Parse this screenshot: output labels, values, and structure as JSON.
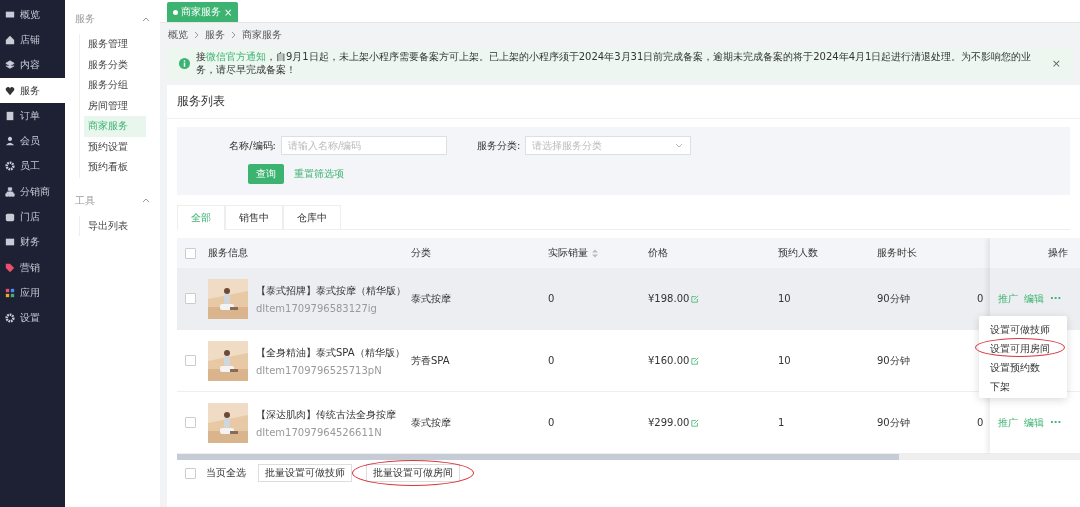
{
  "nav": [
    {
      "label": "概览",
      "selected": false
    },
    {
      "label": "店铺",
      "selected": false
    },
    {
      "label": "内容",
      "selected": false
    },
    {
      "label": "服务",
      "selected": true
    },
    {
      "label": "订单",
      "selected": false
    },
    {
      "label": "会员",
      "selected": false
    },
    {
      "label": "员工",
      "selected": false
    },
    {
      "label": "分销商",
      "selected": false
    },
    {
      "label": "门店",
      "selected": false
    },
    {
      "label": "财务",
      "selected": false
    },
    {
      "label": "营销",
      "selected": false
    },
    {
      "label": "应用",
      "selected": false
    },
    {
      "label": "设置",
      "selected": false
    }
  ],
  "subnav": [
    {
      "title": "服务",
      "expanded": true,
      "items": [
        {
          "label": "服务管理",
          "selected": false
        },
        {
          "label": "服务分类",
          "selected": false
        },
        {
          "label": "服务分组",
          "selected": false
        },
        {
          "label": "房间管理",
          "selected": false
        },
        {
          "label": "商家服务",
          "selected": true
        },
        {
          "label": "预约设置",
          "selected": false
        },
        {
          "label": "预约看板",
          "selected": false
        }
      ]
    },
    {
      "title": "工具",
      "expanded": true,
      "items": [
        {
          "label": "导出列表",
          "selected": false
        }
      ]
    }
  ],
  "page_tab": {
    "label": "商家服务",
    "close": "×"
  },
  "breadcrumb": [
    "概览",
    "服务",
    "商家服务"
  ],
  "notice": {
    "text": "接",
    "link": "微信官方通知",
    "rest": "，自9月1日起，未上架小程序需要备案方可上架。已上架的小程序须于2024年3月31日前完成备案，逾期未完成备案的将于2024年4月1日起进行清退处理。为不影响您的业务，请尽早完成备案！",
    "close": "×"
  },
  "card_title": "服务列表",
  "filters": [
    {
      "label": "名称/编码:",
      "placeholder": "请输入名称/编码",
      "kind": "input"
    },
    {
      "label": "服务分类:",
      "placeholder": "请选择服务分类",
      "kind": "select"
    }
  ],
  "query_button": "查询",
  "reset_link": "重置筛选项",
  "tabs": [
    {
      "label": "全部",
      "selected": true
    },
    {
      "label": "销售中",
      "selected": false
    },
    {
      "label": "仓库中",
      "selected": false
    }
  ],
  "table": {
    "checked": false,
    "columns": [
      "服务信息",
      "分类",
      "实际销量",
      "价格",
      "预约人数",
      "服务时长",
      "操作"
    ],
    "rows": [
      {
        "checked": false,
        "title": "【泰式招牌】泰式按摩（精华版）",
        "code": "dItem1709796583127ig",
        "category": "泰式按摩",
        "sales": "0",
        "price": "¥198.00",
        "count": "10",
        "duration": "90分钟",
        "column_7": "0",
        "hover": true,
        "actions": [
          "推广",
          "编辑",
          "···"
        ]
      },
      {
        "checked": false,
        "title": "【全身精油】泰式SPA（精华版）",
        "code": "dItem1709796525713pN",
        "category": "芳香SPA",
        "sales": "0",
        "price": "¥160.00",
        "count": "10",
        "duration": "90分钟",
        "hover": false
      },
      {
        "checked": false,
        "title": "【深达肌肉】传统古法全身按摩",
        "code": "dItem17097964526611N",
        "category": "泰式按摩",
        "sales": "0",
        "price": "¥299.00",
        "count": "1",
        "duration": "90分钟",
        "column_7": "0",
        "hover": false,
        "actions": [
          "推广",
          "编辑",
          "···"
        ]
      }
    ]
  },
  "menu": [
    {
      "label": "设置可做技师",
      "highlighted": false
    },
    {
      "label": "设置可用房间",
      "highlighted": true
    },
    {
      "label": "设置预约数",
      "highlighted": false
    },
    {
      "label": "下架",
      "highlighted": false
    }
  ],
  "footer": {
    "checked": false,
    "select_all": "当页全选",
    "buttons": [
      {
        "label": "批量设置可做技师",
        "highlighted": false
      },
      {
        "label": "批量设置可做房间",
        "highlighted": true
      }
    ]
  }
}
